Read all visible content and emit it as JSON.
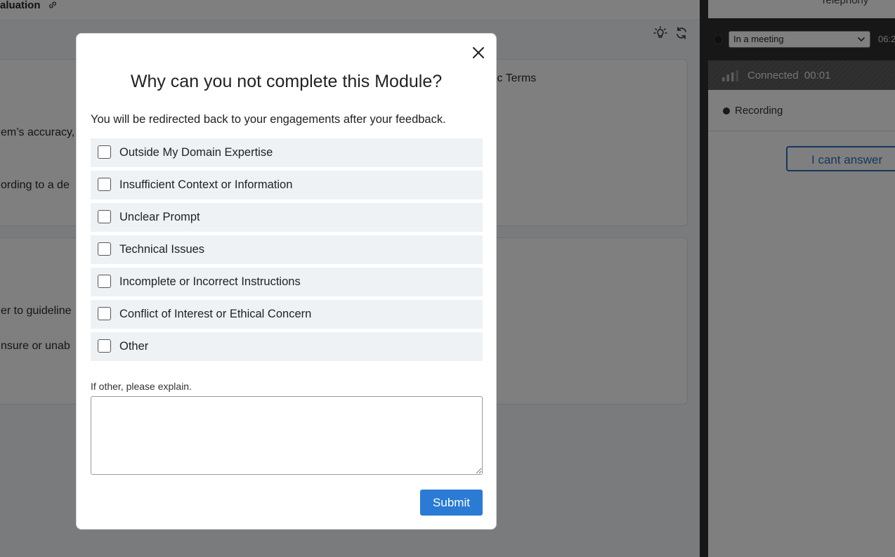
{
  "background": {
    "main_title": "aluation",
    "card1_lines": [
      "em’s accuracy,",
      "ording to a de",
      "ific Terms"
    ],
    "card2_lines": [
      "er to guideline",
      "nsure or unab"
    ]
  },
  "side_panel": {
    "header_title": "Telephony",
    "status_select": "In a meeting",
    "status_time": "06:2",
    "connection_text": "Connected",
    "connection_timer": "00:01",
    "recording_text": "Recording",
    "cant_answer_label": "I cant answer"
  },
  "modal": {
    "title": "Why can you not complete this Module?",
    "subtitle": "You will be redirected back to your engagements after your feedback.",
    "options": [
      "Outside My Domain Expertise",
      "Insufficient Context or Information",
      "Unclear Prompt",
      "Technical Issues",
      "Incomplete or Incorrect Instructions",
      "Conflict of Interest or Ethical Concern",
      "Other"
    ],
    "explain_label": "If other, please explain.",
    "explain_value": "",
    "submit_label": "Submit"
  },
  "colors": {
    "accent": "#2a7bd3",
    "option_bg": "#eef2f4",
    "panel_dark": "#2f2f2f"
  },
  "icons": [
    "link-icon",
    "lightbulb-icon",
    "refresh-icon",
    "chevron-down-icon",
    "signal-icon",
    "close-icon"
  ]
}
